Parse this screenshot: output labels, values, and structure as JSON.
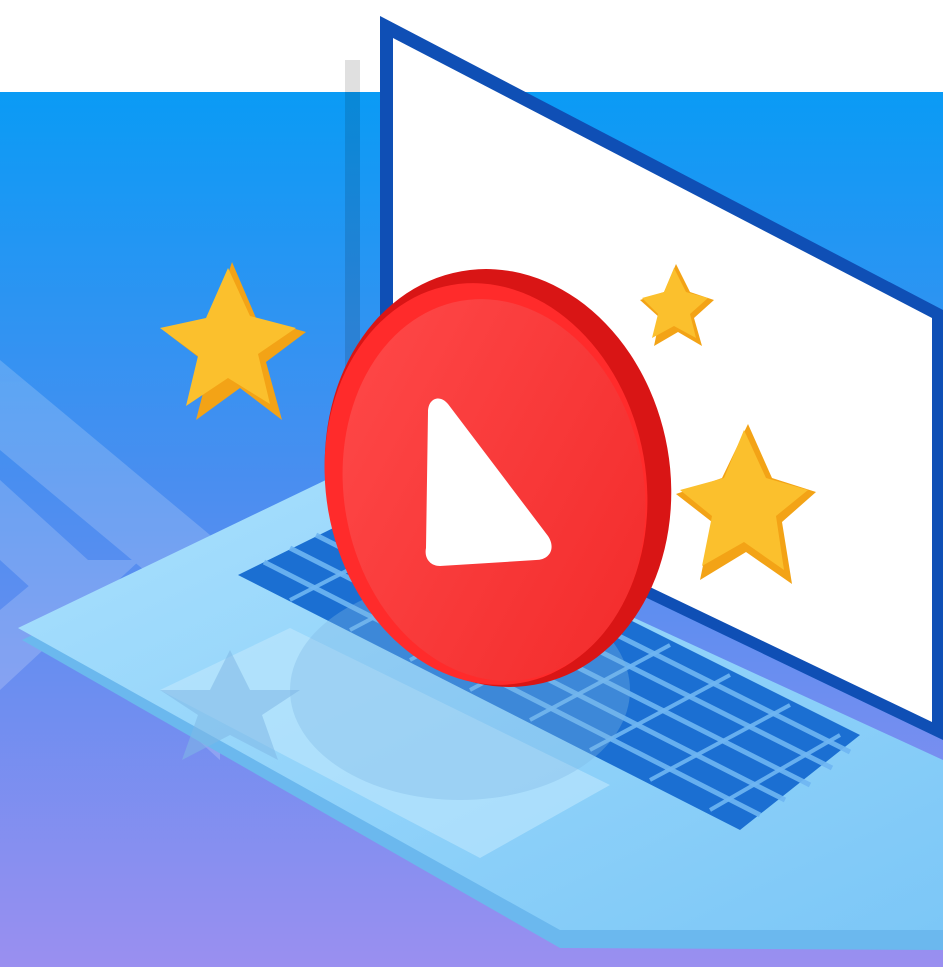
{
  "illustration": {
    "subject": "laptop-with-play-button",
    "icons": [
      "laptop-icon",
      "play-button-icon",
      "star-icon"
    ],
    "colors": {
      "background_top": "#0a9bf5",
      "background_bottom": "#9a8ff0",
      "laptop_screen": "#ffffff",
      "laptop_frame": "#0f4fb5",
      "laptop_base": "#8fd3fb",
      "keyboard_keys": "#1f7fe0",
      "play_button": "#ff3a3a",
      "play_button_rim": "#d91515",
      "play_triangle": "#ffffff",
      "star": "#fbc02d",
      "star_shadow": "#f3a316"
    }
  }
}
